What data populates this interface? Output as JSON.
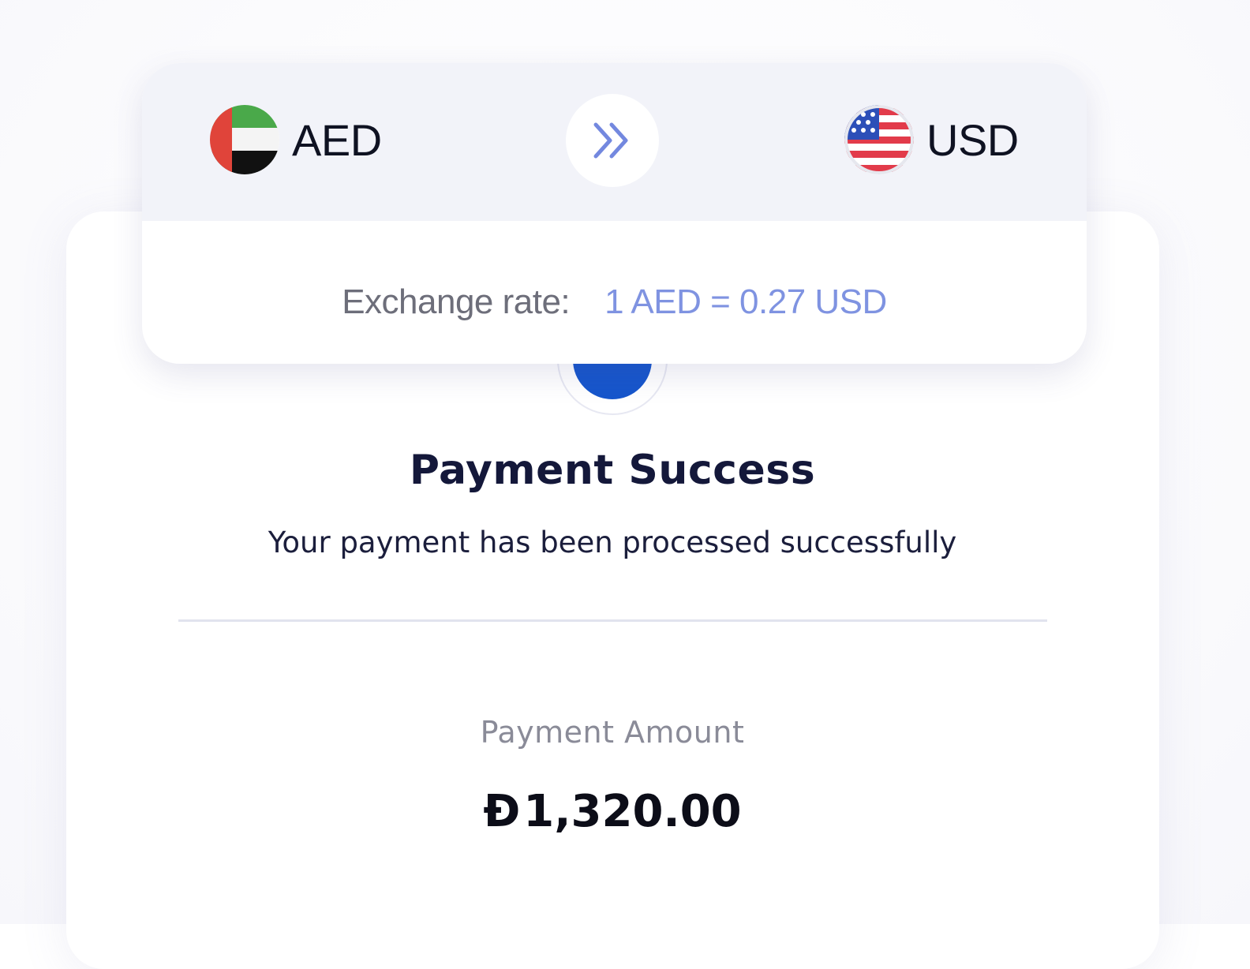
{
  "exchange": {
    "from_currency": "AED",
    "to_currency": "USD",
    "from_flag_icon": "uae-flag-icon",
    "to_flag_icon": "usa-flag-icon",
    "swap_icon": "double-chevron-right-icon",
    "rate_label": "Exchange rate:",
    "rate_value": "1 AED = 0.27 USD"
  },
  "payment": {
    "status_icon": "check-icon",
    "title": "Payment Success",
    "subtitle": "Your payment has been processed successfully",
    "amount_label": "Payment Amount",
    "amount_symbol": "Ð",
    "amount_value": "1,320.00"
  },
  "colors": {
    "accent_blue": "#1656cc",
    "rate_blue": "#7f93e1",
    "header_bg": "#f2f3f9",
    "title_text": "#14183a"
  }
}
